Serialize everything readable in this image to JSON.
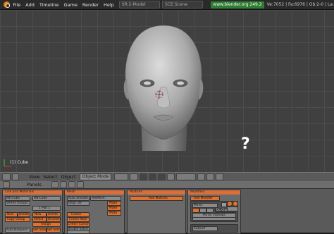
{
  "topbar": {
    "menus": [
      "File",
      "Add",
      "Timeline",
      "Game",
      "Render",
      "Help"
    ],
    "screen_field": "SR:2-Model",
    "scene_field": "SCE:Scene",
    "url": "www.blender.org 249.2",
    "stats": "Ve:7052 | Fa:6976 | Ob:2-0 | La:"
  },
  "viewport": {
    "object_label": "(1) Cube",
    "annotation": "?"
  },
  "view_header": {
    "menus": [
      "View",
      "Select",
      "Object"
    ],
    "mode": "Object Mode"
  },
  "buttons_window": {
    "header_label": "Panels",
    "panels": {
      "link_materials": {
        "title": "Link and Materials",
        "me_field": "ME:Cube",
        "ob_field": "OB:Cube",
        "vertex_groups": "Vertex Groups",
        "mat_field": "1 Mat 1",
        "new": "New",
        "delete": "Delete",
        "copy_group": "Copy Group",
        "assign": "Assign",
        "select": "Select",
        "deselect": "Deselect",
        "autotexspace": "AutoTexSpace",
        "set_smooth": "Set Smooth",
        "set_solid": "Set Solid"
      },
      "mesh": {
        "title": "Mesh",
        "auto_smooth": "Auto Smooth",
        "degr": "Degr: 30",
        "tex_mesh": "TexMesh:",
        "sticky": "Sticky",
        "uv_texture": "UV Texture",
        "vertex_color": "Vertex Color",
        "center": "Center",
        "center_new": "Center New",
        "center_cursor": "Center Cursor",
        "double_sided": "Double Sided",
        "no_vnormal_flip": "No V.Normal Flip",
        "make": "Make"
      },
      "multires": {
        "title": "Multires",
        "add_multires": "Add Multires"
      },
      "modifiers": {
        "title": "Modifiers",
        "add_modifier": "Add Modifier",
        "to": "To: Cube",
        "mirror_name": "Mirror",
        "do_clipping": "Do Clipping",
        "mirror_vgroups": "Mirror Vgroups",
        "merge_limit": "Merge Limit: 0.001",
        "ob_field": "Ob:",
        "apply": "Apply",
        "copy": "Copy",
        "subsurf_name": "Subsurf"
      }
    }
  },
  "colors": {
    "viewport_bg": "#404040",
    "grid_line": "#4c4c4c",
    "panel_title": "#d9703a",
    "button_orange": "#e0712e",
    "url_green": "#2e7d32"
  }
}
